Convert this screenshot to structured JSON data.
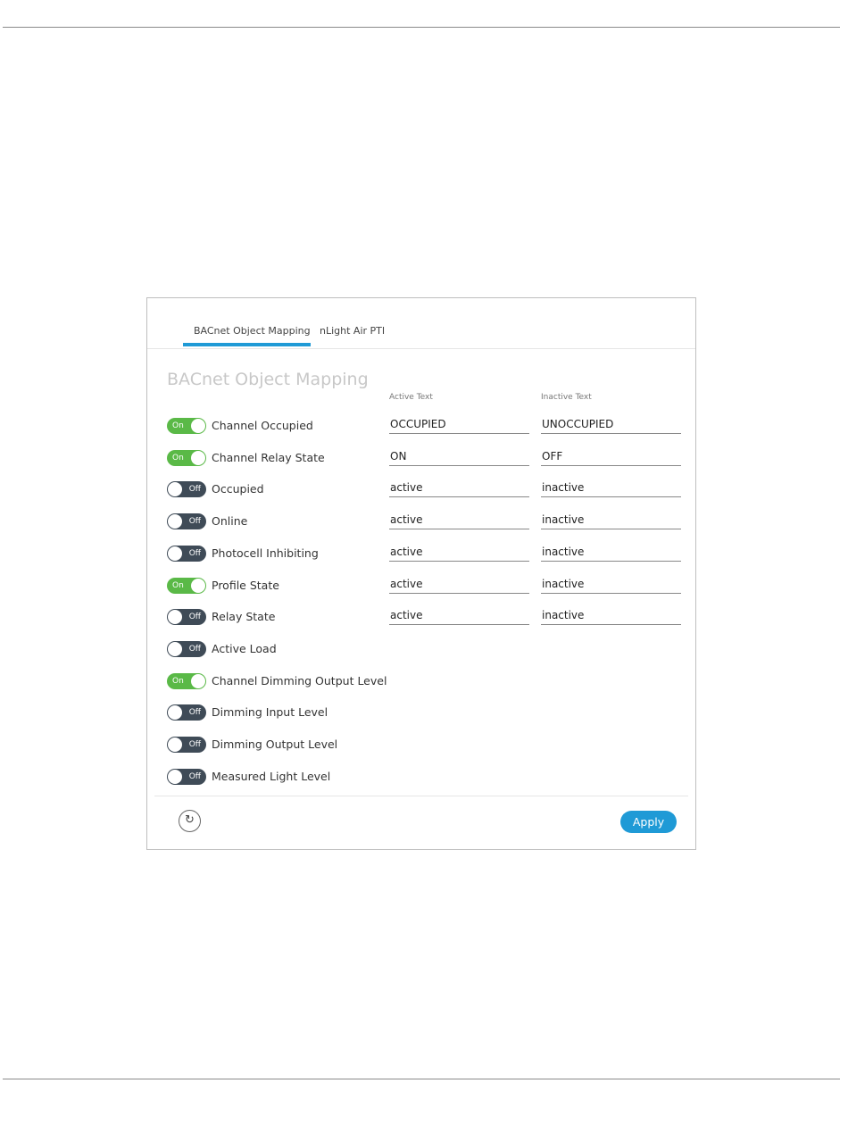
{
  "tabs": [
    "BACnet Object Mapping",
    "nLight Air PTI"
  ],
  "section_title": "BACnet Object Mapping",
  "columns": {
    "active": "Active Text",
    "inactive": "Inactive Text"
  },
  "toggle_text": {
    "on": "On",
    "off": "Off"
  },
  "rows": [
    {
      "label": "Channel Occupied",
      "on": true,
      "active": "OCCUPIED",
      "inactive": "UNOCCUPIED"
    },
    {
      "label": "Channel Relay State",
      "on": true,
      "active": "ON",
      "inactive": "OFF"
    },
    {
      "label": "Occupied",
      "on": false,
      "active": "active",
      "inactive": "inactive"
    },
    {
      "label": "Online",
      "on": false,
      "active": "active",
      "inactive": "inactive"
    },
    {
      "label": "Photocell Inhibiting",
      "on": false,
      "active": "active",
      "inactive": "inactive"
    },
    {
      "label": "Profile State",
      "on": true,
      "active": "active",
      "inactive": "inactive"
    },
    {
      "label": "Relay State",
      "on": false,
      "active": "active",
      "inactive": "inactive"
    },
    {
      "label": "Active Load",
      "on": false
    },
    {
      "label": "Channel Dimming Output Level",
      "on": true
    },
    {
      "label": "Dimming Input Level",
      "on": false
    },
    {
      "label": "Dimming Output Level",
      "on": false
    },
    {
      "label": "Measured Light Level",
      "on": false
    }
  ],
  "footer": {
    "refresh_icon": "↻",
    "apply_label": "Apply"
  },
  "colors": {
    "accent": "#1f9ad6",
    "toggle_on": "#5ab947",
    "toggle_off": "#3f4b57"
  }
}
